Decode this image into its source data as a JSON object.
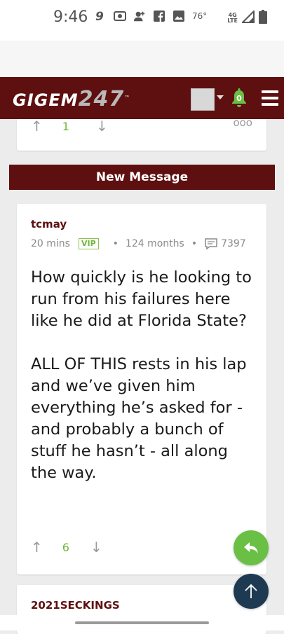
{
  "status_bar": {
    "time": "9:46",
    "temperature": "76°",
    "network": [
      "4G",
      "LTE"
    ],
    "icons": [
      "g-app-icon",
      "camera-icon",
      "add-contact-icon",
      "facebook-icon",
      "image-icon",
      "signal-icon",
      "battery-icon"
    ]
  },
  "header": {
    "logo_text": "GIGEM",
    "logo_number": "247",
    "logo_tm": "™",
    "notification_count": "0",
    "colors": {
      "brand": "#5e0f0f",
      "accent_green": "#6fb63c"
    }
  },
  "prev_post": {
    "upvotes": "1",
    "more_label": "ooo"
  },
  "banner": {
    "label": "New Message"
  },
  "post": {
    "username": "tcmay",
    "age": "20 mins",
    "badge": "VIP",
    "membership": "124 months",
    "post_count": "7397",
    "paragraphs": [
      "How quickly is he looking to run from his failures here like he did at Florida State?",
      "ALL OF THIS rests in his lap and we’ve given him everything he’s asked for - and probably a bunch of stuff he hasn’t - all along the way."
    ],
    "upvotes": "6"
  },
  "next_post": {
    "username": "2021SECKINGS"
  }
}
